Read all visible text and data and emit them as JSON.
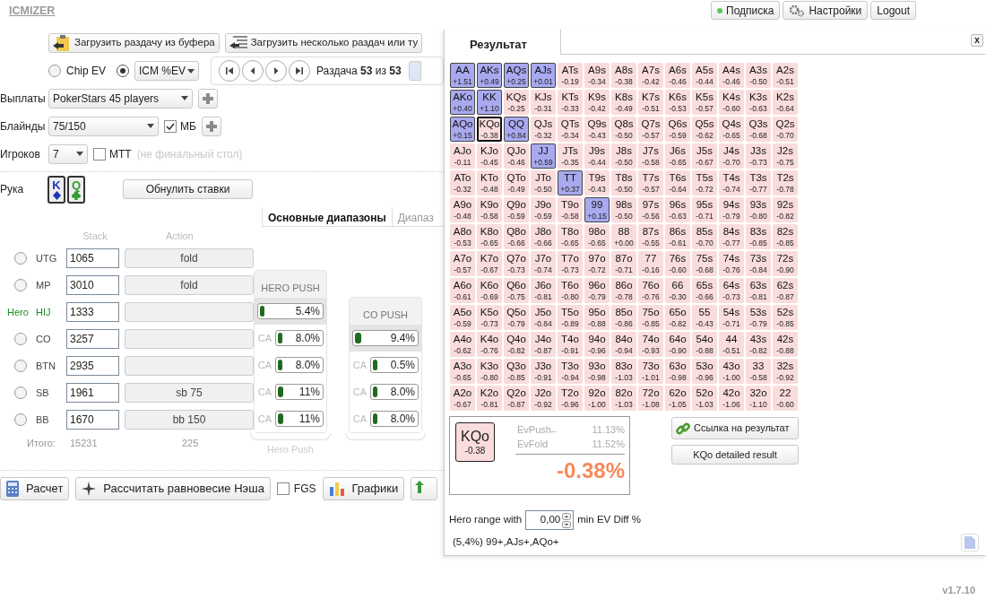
{
  "logo": "ICMIZER",
  "top_buttons": [
    {
      "kind": "status",
      "label": "Подписка"
    },
    {
      "kind": "settings",
      "label": "Настройки"
    },
    {
      "kind": "plain",
      "label": "Logout"
    }
  ],
  "load_buttons": [
    {
      "kind": "clipboard",
      "label": "Загрузить раздачу из буфера"
    },
    {
      "kind": "list",
      "label": "Загрузить несколько раздач или ту"
    }
  ],
  "ev_modes": [
    {
      "kind": "label",
      "label": "Chip EV",
      "selected": false
    },
    {
      "kind": "dropdown",
      "label": "ICM %EV",
      "selected": true
    }
  ],
  "hand_nav": {
    "text": "Раздача **53** из **53**"
  },
  "form": [
    {
      "label": "Выплаты",
      "value": "PokerStars 45 players",
      "kind": "wide",
      "plus": true
    },
    {
      "label": "Блайнды",
      "value": "75/150",
      "kind": "medium",
      "plus": true,
      "checkbox": {
        "label": "МБ",
        "checked": true
      }
    },
    {
      "label": "Игроков",
      "value": "7",
      "kind": "narrow",
      "plus": false,
      "checkbox": {
        "label": "МТТ",
        "checked": false,
        "hint": "(не финальный стол)"
      }
    }
  ],
  "hand": {
    "label": "Рука",
    "cards": [
      {
        "rank": "K",
        "kind": "diamonds",
        "color": "#2233bb"
      },
      {
        "rank": "Q",
        "kind": "clubs",
        "color": "#2e9a2e"
      }
    ]
  },
  "reset_button": "Обнулить ставки",
  "range_tabs": [
    {
      "label": "Основные диапазоны",
      "selected": true
    },
    {
      "label": "Диапаз",
      "selected": false
    }
  ],
  "table_headers": {
    "stack": "Stack",
    "action": "Action"
  },
  "players": [
    {
      "position": "UTG",
      "stack": "1065",
      "action": "fold",
      "hero": false,
      "selected": false
    },
    {
      "position": "MP",
      "stack": "3010",
      "action": "fold",
      "hero": false,
      "selected": false
    },
    {
      "position": "HIJ",
      "stack": "1333",
      "hero": true,
      "hero_label": "Hero"
    },
    {
      "position": "CO",
      "stack": "3257",
      "hero": false,
      "selected": false
    },
    {
      "position": "BTN",
      "stack": "2935",
      "hero": false,
      "selected": false
    },
    {
      "position": "SB",
      "stack": "1961",
      "action": "sb 75",
      "hero": false,
      "selected": false
    },
    {
      "position": "BB",
      "stack": "1670",
      "action": "bb 150",
      "hero": false,
      "selected": false
    }
  ],
  "totals": {
    "label": "Итого:",
    "stack": "15231",
    "action": "225"
  },
  "push_columns": [
    {
      "title": "HERO PUSH",
      "main": {
        "value": "5.4%",
        "level": 0.054
      },
      "footer": "Hero Push",
      "calls": [
        {
          "label": "CA",
          "value": "8.0%",
          "level": 0.08
        },
        {
          "label": "CA",
          "value": "8.0%",
          "level": 0.08
        },
        {
          "label": "CA",
          "value": "11%",
          "level": 0.11
        },
        {
          "label": "CA",
          "value": "11%",
          "level": 0.11
        }
      ]
    },
    {
      "title": "CO PUSH",
      "main": {
        "value": "9.4%",
        "level": 0.094
      },
      "calls": [
        {
          "label": "CA",
          "value": "0.5%",
          "level": 0.005
        },
        {
          "label": "CA",
          "value": "8.0%",
          "level": 0.08
        },
        {
          "label": "CA",
          "value": "8.0%",
          "level": 0.08
        }
      ]
    }
  ],
  "bottom_buttons": [
    {
      "kind": "calculator",
      "label": "Расчет"
    },
    {
      "kind": "star",
      "label": "Рассчитать равновесие Нэша"
    },
    {
      "kind": "checkbox",
      "label": "FGS",
      "checked": false
    },
    {
      "kind": "chart",
      "label": "Графики"
    }
  ],
  "result": {
    "tab": "Результат",
    "close": "x",
    "matrix": [
      [
        {
          "hand": "AA",
          "ev": "+1.51",
          "push": true,
          "selected": false
        },
        {
          "hand": "AKs",
          "ev": "+0.49",
          "push": true,
          "selected": false
        },
        {
          "hand": "AQs",
          "ev": "+0.25",
          "push": true,
          "selected": false
        },
        {
          "hand": "AJs",
          "ev": "+0.01",
          "push": true,
          "selected": false
        },
        {
          "hand": "ATs",
          "ev": "-0.19",
          "push": false,
          "selected": false
        },
        {
          "hand": "A9s",
          "ev": "-0.34",
          "push": false,
          "selected": false
        },
        {
          "hand": "A8s",
          "ev": "-0.38",
          "push": false,
          "selected": false
        },
        {
          "hand": "A7s",
          "ev": "-0.42",
          "push": false,
          "selected": false
        },
        {
          "hand": "A6s",
          "ev": "-0.46",
          "push": false,
          "selected": false
        },
        {
          "hand": "A5s",
          "ev": "-0.44",
          "push": false,
          "selected": false
        },
        {
          "hand": "A4s",
          "ev": "-0.46",
          "push": false,
          "selected": false
        },
        {
          "hand": "A3s",
          "ev": "-0.50",
          "push": false,
          "selected": false
        },
        {
          "hand": "A2s",
          "ev": "-0.51",
          "push": false,
          "selected": false
        }
      ],
      [
        {
          "hand": "AKo",
          "ev": "+0.40",
          "push": true,
          "selected": false
        },
        {
          "hand": "KK",
          "ev": "+1.10",
          "push": true,
          "selected": false
        },
        {
          "hand": "KQs",
          "ev": "-0.25",
          "push": false,
          "selected": false
        },
        {
          "hand": "KJs",
          "ev": "-0.31",
          "push": false,
          "selected": false
        },
        {
          "hand": "KTs",
          "ev": "-0.33",
          "push": false,
          "selected": false
        },
        {
          "hand": "K9s",
          "ev": "-0.42",
          "push": false,
          "selected": false
        },
        {
          "hand": "K8s",
          "ev": "-0.49",
          "push": false,
          "selected": false
        },
        {
          "hand": "K7s",
          "ev": "-0.51",
          "push": false,
          "selected": false
        },
        {
          "hand": "K6s",
          "ev": "-0.53",
          "push": false,
          "selected": false
        },
        {
          "hand": "K5s",
          "ev": "-0.57",
          "push": false,
          "selected": false
        },
        {
          "hand": "K4s",
          "ev": "-0.60",
          "push": false,
          "selected": false
        },
        {
          "hand": "K3s",
          "ev": "-0.63",
          "push": false,
          "selected": false
        },
        {
          "hand": "K2s",
          "ev": "-0.64",
          "push": false,
          "selected": false
        }
      ],
      [
        {
          "hand": "AQo",
          "ev": "+0.15",
          "push": true,
          "selected": false
        },
        {
          "hand": "KQo",
          "ev": "-0.38",
          "push": false,
          "selected": true
        },
        {
          "hand": "QQ",
          "ev": "+0.84",
          "push": true,
          "selected": false
        },
        {
          "hand": "QJs",
          "ev": "-0.32",
          "push": false,
          "selected": false
        },
        {
          "hand": "QTs",
          "ev": "-0.34",
          "push": false,
          "selected": false
        },
        {
          "hand": "Q9s",
          "ev": "-0.43",
          "push": false,
          "selected": false
        },
        {
          "hand": "Q8s",
          "ev": "-0.50",
          "push": false,
          "selected": false
        },
        {
          "hand": "Q7s",
          "ev": "-0.57",
          "push": false,
          "selected": false
        },
        {
          "hand": "Q6s",
          "ev": "-0.59",
          "push": false,
          "selected": false
        },
        {
          "hand": "Q5s",
          "ev": "-0.62",
          "push": false,
          "selected": false
        },
        {
          "hand": "Q4s",
          "ev": "-0.65",
          "push": false,
          "selected": false
        },
        {
          "hand": "Q3s",
          "ev": "-0.68",
          "push": false,
          "selected": false
        },
        {
          "hand": "Q2s",
          "ev": "-0.70",
          "push": false,
          "selected": false
        }
      ],
      [
        {
          "hand": "AJo",
          "ev": "-0.11",
          "push": false,
          "selected": false
        },
        {
          "hand": "KJo",
          "ev": "-0.45",
          "push": false,
          "selected": false
        },
        {
          "hand": "QJo",
          "ev": "-0.46",
          "push": false,
          "selected": false
        },
        {
          "hand": "JJ",
          "ev": "+0.59",
          "push": true,
          "selected": false
        },
        {
          "hand": "JTs",
          "ev": "-0.35",
          "push": false,
          "selected": false
        },
        {
          "hand": "J9s",
          "ev": "-0.44",
          "push": false,
          "selected": false
        },
        {
          "hand": "J8s",
          "ev": "-0.50",
          "push": false,
          "selected": false
        },
        {
          "hand": "J7s",
          "ev": "-0.58",
          "push": false,
          "selected": false
        },
        {
          "hand": "J6s",
          "ev": "-0.65",
          "push": false,
          "selected": false
        },
        {
          "hand": "J5s",
          "ev": "-0.67",
          "push": false,
          "selected": false
        },
        {
          "hand": "J4s",
          "ev": "-0.70",
          "push": false,
          "selected": false
        },
        {
          "hand": "J3s",
          "ev": "-0.73",
          "push": false,
          "selected": false
        },
        {
          "hand": "J2s",
          "ev": "-0.75",
          "push": false,
          "selected": false
        }
      ],
      [
        {
          "hand": "ATo",
          "ev": "-0.32",
          "push": false,
          "selected": false
        },
        {
          "hand": "KTo",
          "ev": "-0.48",
          "push": false,
          "selected": false
        },
        {
          "hand": "QTo",
          "ev": "-0.49",
          "push": false,
          "selected": false
        },
        {
          "hand": "JTo",
          "ev": "-0.50",
          "push": false,
          "selected": false
        },
        {
          "hand": "TT",
          "ev": "+0.37",
          "push": true,
          "selected": false
        },
        {
          "hand": "T9s",
          "ev": "-0.43",
          "push": false,
          "selected": false
        },
        {
          "hand": "T8s",
          "ev": "-0.50",
          "push": false,
          "selected": false
        },
        {
          "hand": "T7s",
          "ev": "-0.57",
          "push": false,
          "selected": false
        },
        {
          "hand": "T6s",
          "ev": "-0.64",
          "push": false,
          "selected": false
        },
        {
          "hand": "T5s",
          "ev": "-0.72",
          "push": false,
          "selected": false
        },
        {
          "hand": "T4s",
          "ev": "-0.74",
          "push": false,
          "selected": false
        },
        {
          "hand": "T3s",
          "ev": "-0.77",
          "push": false,
          "selected": false
        },
        {
          "hand": "T2s",
          "ev": "-0.78",
          "push": false,
          "selected": false
        }
      ],
      [
        {
          "hand": "A9o",
          "ev": "-0.48",
          "push": false,
          "selected": false
        },
        {
          "hand": "K9o",
          "ev": "-0.58",
          "push": false,
          "selected": false
        },
        {
          "hand": "Q9o",
          "ev": "-0.59",
          "push": false,
          "selected": false
        },
        {
          "hand": "J9o",
          "ev": "-0.59",
          "push": false,
          "selected": false
        },
        {
          "hand": "T9o",
          "ev": "-0.58",
          "push": false,
          "selected": false
        },
        {
          "hand": "99",
          "ev": "+0.15",
          "push": true,
          "selected": false
        },
        {
          "hand": "98s",
          "ev": "-0.50",
          "push": false,
          "selected": false
        },
        {
          "hand": "97s",
          "ev": "-0.56",
          "push": false,
          "selected": false
        },
        {
          "hand": "96s",
          "ev": "-0.63",
          "push": false,
          "selected": false
        },
        {
          "hand": "95s",
          "ev": "-0.71",
          "push": false,
          "selected": false
        },
        {
          "hand": "94s",
          "ev": "-0.79",
          "push": false,
          "selected": false
        },
        {
          "hand": "93s",
          "ev": "-0.80",
          "push": false,
          "selected": false
        },
        {
          "hand": "92s",
          "ev": "-0.82",
          "push": false,
          "selected": false
        }
      ],
      [
        {
          "hand": "A8o",
          "ev": "-0.53",
          "push": false,
          "selected": false
        },
        {
          "hand": "K8o",
          "ev": "-0.65",
          "push": false,
          "selected": false
        },
        {
          "hand": "Q8o",
          "ev": "-0.66",
          "push": false,
          "selected": false
        },
        {
          "hand": "J8o",
          "ev": "-0.66",
          "push": false,
          "selected": false
        },
        {
          "hand": "T8o",
          "ev": "-0.65",
          "push": false,
          "selected": false
        },
        {
          "hand": "98o",
          "ev": "-0.65",
          "push": false,
          "selected": false
        },
        {
          "hand": "88",
          "ev": "+0.00",
          "push": false,
          "selected": false
        },
        {
          "hand": "87s",
          "ev": "-0.55",
          "push": false,
          "selected": false
        },
        {
          "hand": "86s",
          "ev": "-0.61",
          "push": false,
          "selected": false
        },
        {
          "hand": "85s",
          "ev": "-0.70",
          "push": false,
          "selected": false
        },
        {
          "hand": "84s",
          "ev": "-0.77",
          "push": false,
          "selected": false
        },
        {
          "hand": "83s",
          "ev": "-0.85",
          "push": false,
          "selected": false
        },
        {
          "hand": "82s",
          "ev": "-0.85",
          "push": false,
          "selected": false
        }
      ],
      [
        {
          "hand": "A7o",
          "ev": "-0.57",
          "push": false,
          "selected": false
        },
        {
          "hand": "K7o",
          "ev": "-0.67",
          "push": false,
          "selected": false
        },
        {
          "hand": "Q7o",
          "ev": "-0.73",
          "push": false,
          "selected": false
        },
        {
          "hand": "J7o",
          "ev": "-0.74",
          "push": false,
          "selected": false
        },
        {
          "hand": "T7o",
          "ev": "-0.73",
          "push": false,
          "selected": false
        },
        {
          "hand": "97o",
          "ev": "-0.72",
          "push": false,
          "selected": false
        },
        {
          "hand": "87o",
          "ev": "-0.71",
          "push": false,
          "selected": false
        },
        {
          "hand": "77",
          "ev": "-0.16",
          "push": false,
          "selected": false
        },
        {
          "hand": "76s",
          "ev": "-0.60",
          "push": false,
          "selected": false
        },
        {
          "hand": "75s",
          "ev": "-0.68",
          "push": false,
          "selected": false
        },
        {
          "hand": "74s",
          "ev": "-0.76",
          "push": false,
          "selected": false
        },
        {
          "hand": "73s",
          "ev": "-0.84",
          "push": false,
          "selected": false
        },
        {
          "hand": "72s",
          "ev": "-0.90",
          "push": false,
          "selected": false
        }
      ],
      [
        {
          "hand": "A6o",
          "ev": "-0.61",
          "push": false,
          "selected": false
        },
        {
          "hand": "K6o",
          "ev": "-0.69",
          "push": false,
          "selected": false
        },
        {
          "hand": "Q6o",
          "ev": "-0.75",
          "push": false,
          "selected": false
        },
        {
          "hand": "J6o",
          "ev": "-0.81",
          "push": false,
          "selected": false
        },
        {
          "hand": "T6o",
          "ev": "-0.80",
          "push": false,
          "selected": false
        },
        {
          "hand": "96o",
          "ev": "-0.79",
          "push": false,
          "selected": false
        },
        {
          "hand": "86o",
          "ev": "-0.78",
          "push": false,
          "selected": false
        },
        {
          "hand": "76o",
          "ev": "-0.76",
          "push": false,
          "selected": false
        },
        {
          "hand": "66",
          "ev": "-0.30",
          "push": false,
          "selected": false
        },
        {
          "hand": "65s",
          "ev": "-0.66",
          "push": false,
          "selected": false
        },
        {
          "hand": "64s",
          "ev": "-0.73",
          "push": false,
          "selected": false
        },
        {
          "hand": "63s",
          "ev": "-0.81",
          "push": false,
          "selected": false
        },
        {
          "hand": "62s",
          "ev": "-0.87",
          "push": false,
          "selected": false
        }
      ],
      [
        {
          "hand": "A5o",
          "ev": "-0.59",
          "push": false,
          "selected": false
        },
        {
          "hand": "K5o",
          "ev": "-0.73",
          "push": false,
          "selected": false
        },
        {
          "hand": "Q5o",
          "ev": "-0.79",
          "push": false,
          "selected": false
        },
        {
          "hand": "J5o",
          "ev": "-0.84",
          "push": false,
          "selected": false
        },
        {
          "hand": "T5o",
          "ev": "-0.89",
          "push": false,
          "selected": false
        },
        {
          "hand": "95o",
          "ev": "-0.88",
          "push": false,
          "selected": false
        },
        {
          "hand": "85o",
          "ev": "-0.86",
          "push": false,
          "selected": false
        },
        {
          "hand": "75o",
          "ev": "-0.85",
          "push": false,
          "selected": false
        },
        {
          "hand": "65o",
          "ev": "-0.82",
          "push": false,
          "selected": false
        },
        {
          "hand": "55",
          "ev": "-0.43",
          "push": false,
          "selected": false
        },
        {
          "hand": "54s",
          "ev": "-0.71",
          "push": false,
          "selected": false
        },
        {
          "hand": "53s",
          "ev": "-0.79",
          "push": false,
          "selected": false
        },
        {
          "hand": "52s",
          "ev": "-0.85",
          "push": false,
          "selected": false
        }
      ],
      [
        {
          "hand": "A4o",
          "ev": "-0.62",
          "push": false,
          "selected": false
        },
        {
          "hand": "K4o",
          "ev": "-0.76",
          "push": false,
          "selected": false
        },
        {
          "hand": "Q4o",
          "ev": "-0.82",
          "push": false,
          "selected": false
        },
        {
          "hand": "J4o",
          "ev": "-0.87",
          "push": false,
          "selected": false
        },
        {
          "hand": "T4o",
          "ev": "-0.91",
          "push": false,
          "selected": false
        },
        {
          "hand": "94o",
          "ev": "-0.96",
          "push": false,
          "selected": false
        },
        {
          "hand": "84o",
          "ev": "-0.94",
          "push": false,
          "selected": false
        },
        {
          "hand": "74o",
          "ev": "-0.93",
          "push": false,
          "selected": false
        },
        {
          "hand": "64o",
          "ev": "-0.90",
          "push": false,
          "selected": false
        },
        {
          "hand": "54o",
          "ev": "-0.88",
          "push": false,
          "selected": false
        },
        {
          "hand": "44",
          "ev": "-0.51",
          "push": false,
          "selected": false
        },
        {
          "hand": "43s",
          "ev": "-0.82",
          "push": false,
          "selected": false
        },
        {
          "hand": "42s",
          "ev": "-0.88",
          "push": false,
          "selected": false
        }
      ],
      [
        {
          "hand": "A3o",
          "ev": "-0.65",
          "push": false,
          "selected": false
        },
        {
          "hand": "K3o",
          "ev": "-0.80",
          "push": false,
          "selected": false
        },
        {
          "hand": "Q3o",
          "ev": "-0.85",
          "push": false,
          "selected": false
        },
        {
          "hand": "J3o",
          "ev": "-0.91",
          "push": false,
          "selected": false
        },
        {
          "hand": "T3o",
          "ev": "-0.94",
          "push": false,
          "selected": false
        },
        {
          "hand": "93o",
          "ev": "-0.98",
          "push": false,
          "selected": false
        },
        {
          "hand": "83o",
          "ev": "-1.03",
          "push": false,
          "selected": false
        },
        {
          "hand": "73o",
          "ev": "-1.01",
          "push": false,
          "selected": false
        },
        {
          "hand": "63o",
          "ev": "-0.98",
          "push": false,
          "selected": false
        },
        {
          "hand": "53o",
          "ev": "-0.96",
          "push": false,
          "selected": false
        },
        {
          "hand": "43o",
          "ev": "-1.00",
          "push": false,
          "selected": false
        },
        {
          "hand": "33",
          "ev": "-0.58",
          "push": false,
          "selected": false
        },
        {
          "hand": "32s",
          "ev": "-0.92",
          "push": false,
          "selected": false
        }
      ],
      [
        {
          "hand": "A2o",
          "ev": "-0.67",
          "push": false,
          "selected": false
        },
        {
          "hand": "K2o",
          "ev": "-0.81",
          "push": false,
          "selected": false
        },
        {
          "hand": "Q2o",
          "ev": "-0.87",
          "push": false,
          "selected": false
        },
        {
          "hand": "J2o",
          "ev": "-0.92",
          "push": false,
          "selected": false
        },
        {
          "hand": "T2o",
          "ev": "-0.96",
          "push": false,
          "selected": false
        },
        {
          "hand": "92o",
          "ev": "-1.00",
          "push": false,
          "selected": false
        },
        {
          "hand": "82o",
          "ev": "-1.03",
          "push": false,
          "selected": false
        },
        {
          "hand": "72o",
          "ev": "-1.08",
          "push": false,
          "selected": false
        },
        {
          "hand": "62o",
          "ev": "-1.05",
          "push": false,
          "selected": false
        },
        {
          "hand": "52o",
          "ev": "-1.03",
          "push": false,
          "selected": false
        },
        {
          "hand": "42o",
          "ev": "-1.06",
          "push": false,
          "selected": false
        },
        {
          "hand": "32o",
          "ev": "-1.10",
          "push": false,
          "selected": false
        },
        {
          "hand": "22",
          "ev": "-0.60",
          "push": false,
          "selected": false
        }
      ]
    ],
    "detail": {
      "hand": "KQo",
      "ev": "-0.38",
      "rows": [
        {
          "label": "EvPush",
          "value": "11.13%"
        },
        {
          "label": "EvFold",
          "value": "11.52%"
        }
      ],
      "minus": "_",
      "diff": "-0.38%"
    },
    "link_button": "Ссылка на результат",
    "detail_button": "KQo detailed result",
    "range_filter": {
      "before": "Hero range with",
      "value": "0,00",
      "after": "min EV Diff %"
    },
    "range_text": "(5,4%) 99+,AJs+,AQo+"
  },
  "version": "v1.7.10"
}
